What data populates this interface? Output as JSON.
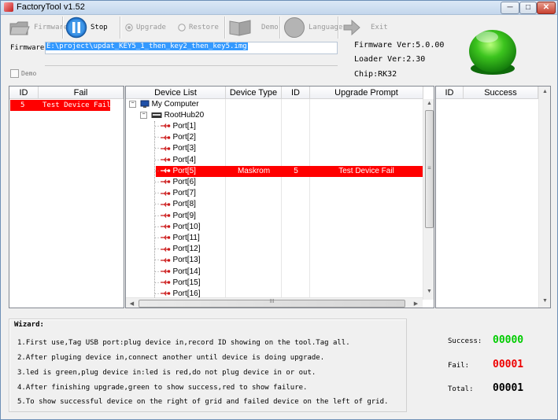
{
  "window": {
    "title": "FactoryTool v1.52",
    "min": "─",
    "max": "□",
    "close": "✕"
  },
  "toolbar": {
    "firmware": "Firmware",
    "stop": "Stop",
    "upgrade": "Upgrade",
    "restore": "Restore",
    "demo": "Demo",
    "language": "Language",
    "exit": "Exit"
  },
  "firmware": {
    "label": "Firmware",
    "path": "E:\\project\\updat_KEY5_1_then_key2_then_key5.img",
    "version": "Firmware Ver:5.0.00",
    "loader": "Loader Ver:2.30",
    "chip": "Chip:RK32"
  },
  "demo_checkbox": {
    "label": "Demo",
    "checked": false
  },
  "status_color": "#22aa22",
  "fail_table": {
    "headers": [
      "ID",
      "Fail"
    ],
    "rows": [
      {
        "id": "5",
        "status": "Test Device Fail"
      }
    ]
  },
  "device_table": {
    "headers": [
      "Device List",
      "Device Type",
      "ID",
      "Upgrade Prompt"
    ],
    "root": "My Computer",
    "hub": "RootHub20",
    "ports": [
      {
        "name": "Port[1]",
        "type": "",
        "id": "",
        "prompt": ""
      },
      {
        "name": "Port[2]",
        "type": "",
        "id": "",
        "prompt": ""
      },
      {
        "name": "Port[3]",
        "type": "",
        "id": "",
        "prompt": ""
      },
      {
        "name": "Port[4]",
        "type": "",
        "id": "",
        "prompt": ""
      },
      {
        "name": "Port[5]",
        "type": "Maskrom",
        "id": "5",
        "prompt": "Test Device Fail"
      },
      {
        "name": "Port[6]",
        "type": "",
        "id": "",
        "prompt": ""
      },
      {
        "name": "Port[7]",
        "type": "",
        "id": "",
        "prompt": ""
      },
      {
        "name": "Port[8]",
        "type": "",
        "id": "",
        "prompt": ""
      },
      {
        "name": "Port[9]",
        "type": "",
        "id": "",
        "prompt": ""
      },
      {
        "name": "Port[10]",
        "type": "",
        "id": "",
        "prompt": ""
      },
      {
        "name": "Port[11]",
        "type": "",
        "id": "",
        "prompt": ""
      },
      {
        "name": "Port[12]",
        "type": "",
        "id": "",
        "prompt": ""
      },
      {
        "name": "Port[13]",
        "type": "",
        "id": "",
        "prompt": ""
      },
      {
        "name": "Port[14]",
        "type": "",
        "id": "",
        "prompt": ""
      },
      {
        "name": "Port[15]",
        "type": "",
        "id": "",
        "prompt": ""
      },
      {
        "name": "Port[16]",
        "type": "",
        "id": "",
        "prompt": ""
      }
    ],
    "scroll_mid": "≡",
    "hscroll_mid": "III"
  },
  "success_table": {
    "headers": [
      "ID",
      "Success"
    ]
  },
  "wizard": {
    "title": "Wizard:",
    "lines": [
      "1.First use,Tag USB port:plug device in,record ID showing on the tool.Tag all.",
      "2.After pluging device in,connect another until device is doing upgrade.",
      "3.led is green,plug device in:led is red,do not plug device in or out.",
      "4.After finishing upgrade,green to show success,red to show failure.",
      "5.To show successful device on the right of grid and failed device on the left of grid."
    ]
  },
  "stats": {
    "success_label": "Success:",
    "success_value": "00000",
    "fail_label": "Fail:",
    "fail_value": "00001",
    "total_label": "Total:",
    "total_value": "00001",
    "success_color": "#00cc00",
    "fail_color": "#ee0000",
    "total_color": "#000000"
  }
}
